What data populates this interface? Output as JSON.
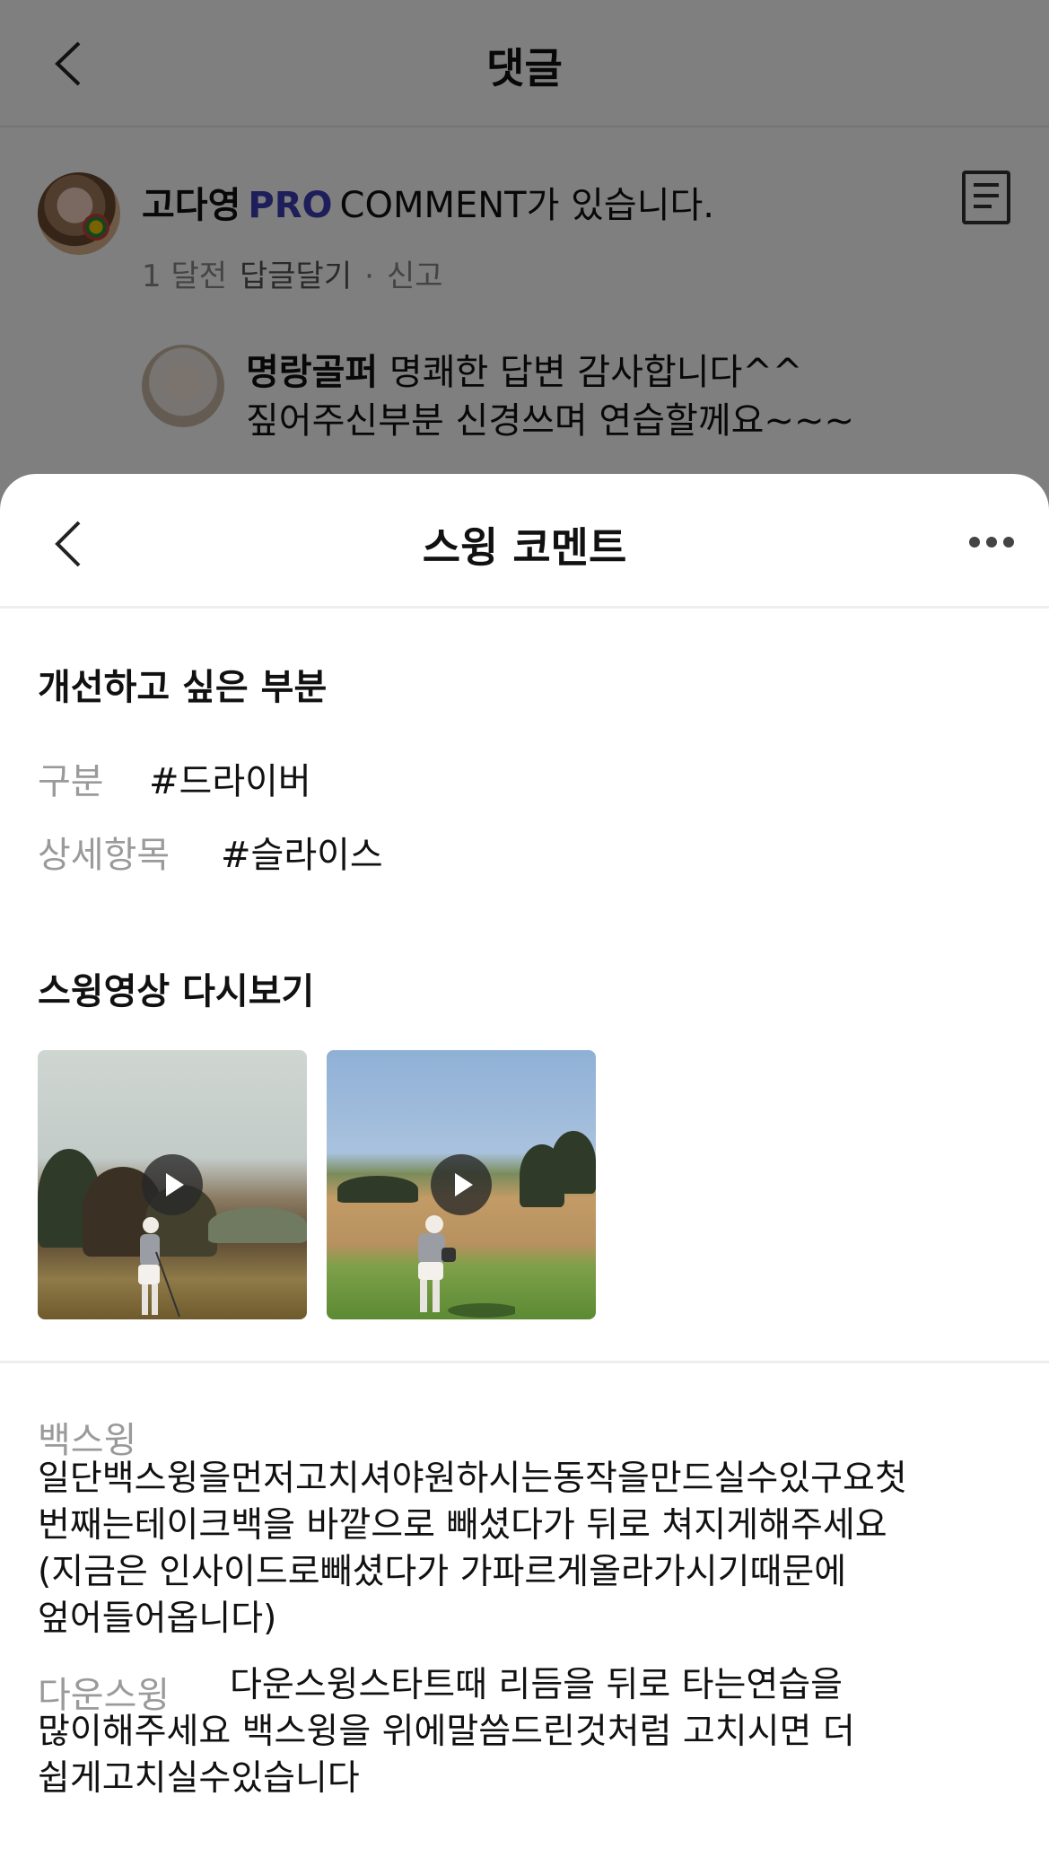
{
  "comments_screen": {
    "title": "댓글",
    "comment": {
      "author": "고다영",
      "badge": "PRO",
      "text": "COMMENT가 있습니다.",
      "time": "1 달전",
      "reply_label": "답글달기",
      "separator": "·",
      "report_label": "신고"
    },
    "reply": {
      "author": "명랑골퍼",
      "text_line1": "명쾌한 답변 감사합니다^^",
      "text_line2": "짚어주신부분 신경쓰며 연습할께요~~~"
    }
  },
  "sheet": {
    "title": "스윙 코멘트",
    "improve_section_title": "개선하고 싶은 부분",
    "category_label": "구분",
    "category_value": "#드라이버",
    "detail_label": "상세항목",
    "detail_value": "#슬라이스",
    "replay_section_title": "스윙영상 다시보기",
    "videos": [
      {
        "icon": "play-icon"
      },
      {
        "icon": "play-icon"
      }
    ],
    "backswing_label": "백스윙",
    "backswing_lines": [
      "일단백스윙을먼저고치셔야원하시는동작을만드실수있구요첫",
      "번째는테이크백을 바깥으로 빼셨다가 뒤로 쳐지게해주세요",
      "(지금은 인사이드로빼셨다가 가파르게올라가시기때문에",
      "엎어들어옵니다)"
    ],
    "downswing_label": "다운스윙",
    "downswing_lines": [
      "다운스윙스타트때 리듬을 뒤로 타는연습을",
      "많이해주세요 백스윙을 위에말씀드린것처럼 고치시면 더",
      "쉽게고치실수있습니다"
    ]
  },
  "colors": {
    "pro_badge": "#3d3db5",
    "label_gray": "#9a9a9a",
    "overlay": "rgba(0,0,0,0.5)"
  }
}
